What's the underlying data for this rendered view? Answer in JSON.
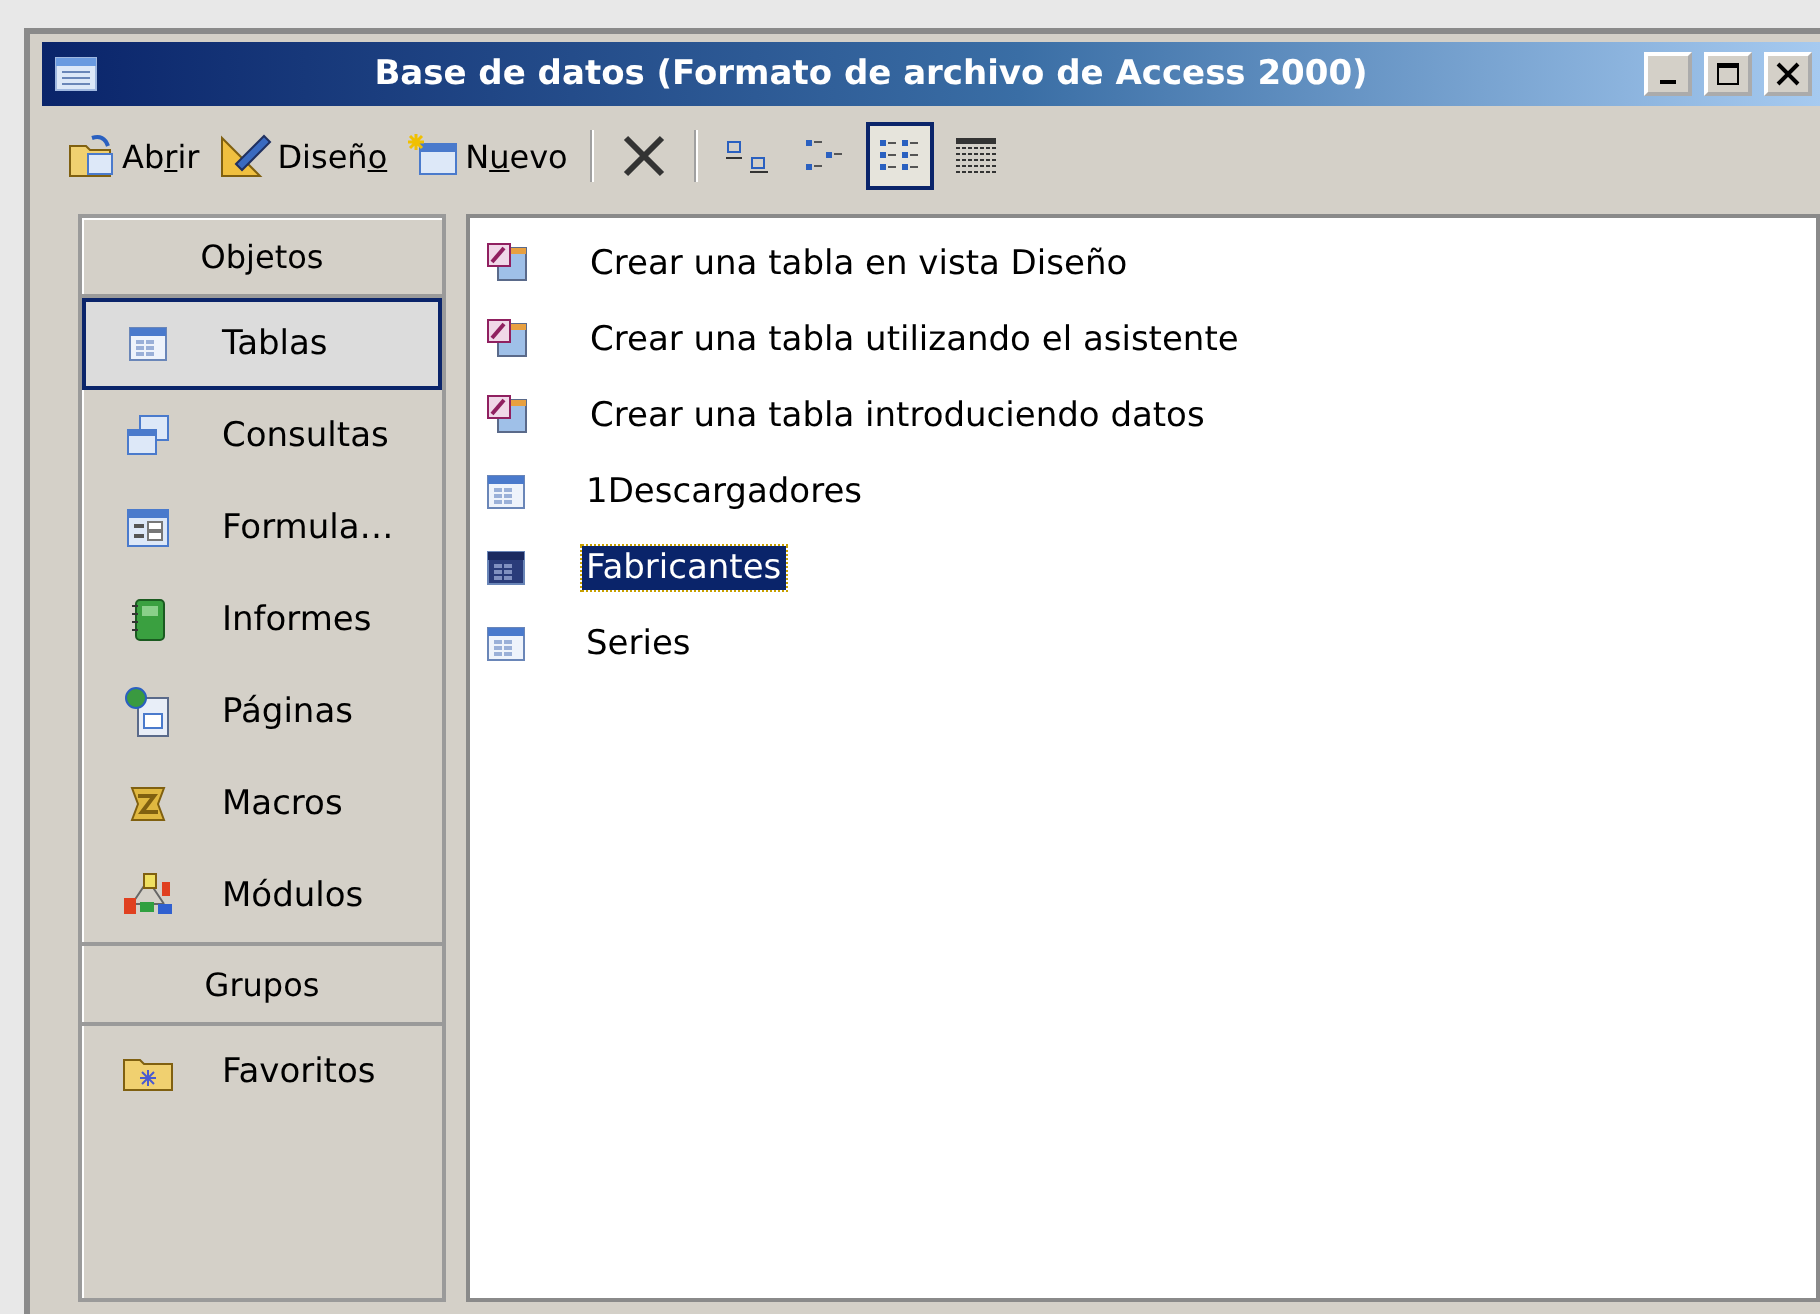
{
  "window": {
    "title": "Base de datos (Formato de archivo de Access 2000)"
  },
  "toolbar": {
    "commands": [
      {
        "kind": "open",
        "before": "Ab",
        "accent": "r",
        "after": "ir"
      },
      {
        "kind": "design",
        "before": "Diseñ",
        "accent": "o"
      },
      {
        "kind": "new",
        "before": "N",
        "accent": "u",
        "after": "evo"
      }
    ],
    "views": [
      {
        "kind": "delete",
        "selected": false
      },
      {
        "kind": "large",
        "selected": false
      },
      {
        "kind": "small",
        "selected": false
      },
      {
        "kind": "list",
        "selected": true
      },
      {
        "kind": "details",
        "selected": false
      }
    ]
  },
  "sidebar": {
    "objects_header": "Objetos",
    "objects": [
      {
        "kind": "table",
        "label": "Tablas",
        "selected": true
      },
      {
        "kind": "query",
        "label": "Consultas",
        "selected": false
      },
      {
        "kind": "form",
        "label": "Formula…",
        "selected": false
      },
      {
        "kind": "report",
        "label": "Informes",
        "selected": false
      },
      {
        "kind": "page",
        "label": "Páginas",
        "selected": false
      },
      {
        "kind": "macro",
        "label": "Macros",
        "selected": false
      },
      {
        "kind": "module",
        "label": "Módulos",
        "selected": false
      }
    ],
    "groups_header": "Grupos",
    "groups": [
      {
        "kind": "folder",
        "label": "Favoritos",
        "selected": false
      }
    ]
  },
  "list": [
    {
      "kind": "wizard",
      "label": "Crear una tabla en vista Diseño",
      "selected": false
    },
    {
      "kind": "wizard",
      "label": "Crear una tabla utilizando el asistente",
      "selected": false
    },
    {
      "kind": "wizard",
      "label": "Crear una tabla introduciendo datos",
      "selected": false
    },
    {
      "kind": "table",
      "label": "1Descargadores",
      "selected": false
    },
    {
      "kind": "table",
      "label": "Fabricantes",
      "selected": true
    },
    {
      "kind": "table",
      "label": "Series",
      "selected": false
    }
  ]
}
